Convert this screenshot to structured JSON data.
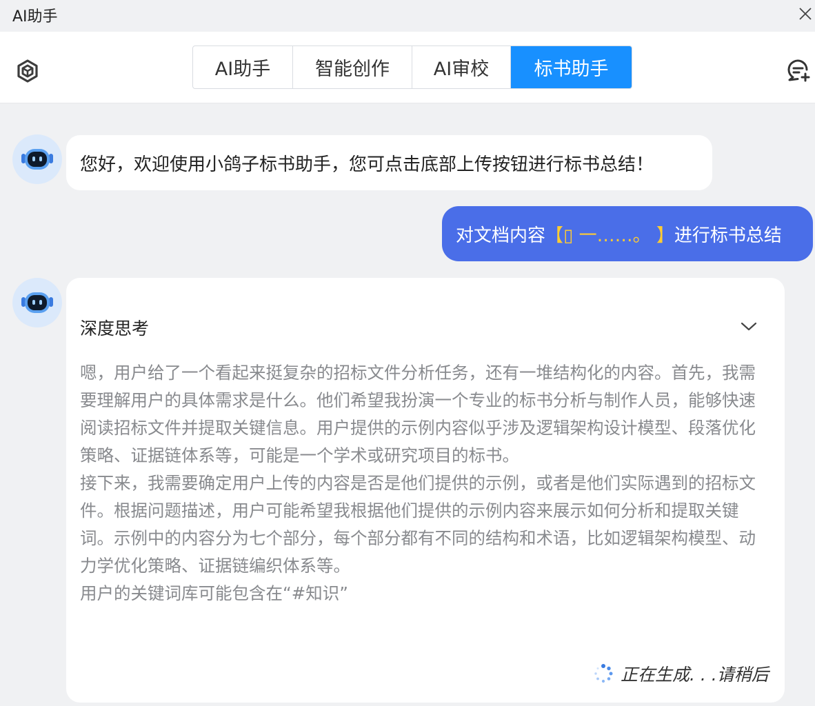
{
  "window": {
    "title": "AI助手"
  },
  "tabs": [
    {
      "label": "AI助手",
      "active": false
    },
    {
      "label": "智能创作",
      "active": false
    },
    {
      "label": "AI审校",
      "active": false
    },
    {
      "label": "标书助手",
      "active": true
    }
  ],
  "colors": {
    "accent": "#1890ff",
    "user_bubble": "#4a6ee8",
    "highlight": "#ffcc33"
  },
  "icons": {
    "logo": "cube-logo-icon",
    "new_chat": "new-chat-icon",
    "close": "close-icon",
    "collapse": "chevron-down-icon",
    "bot": "robot-icon",
    "loading": "spinner-icon"
  },
  "messages": {
    "greeting": "您好，欢迎使用小鸽子标书助手，您可点击底部上传按钮进行标书总结！",
    "user": {
      "prefix": "对文档内容",
      "highlight": "【▯ 一……。 】",
      "suffix": "进行标书总结"
    },
    "assistant": {
      "think_title": "深度思考",
      "paragraphs": [
        "嗯，用户给了一个看起来挺复杂的招标文件分析任务，还有一堆结构化的内容。首先，我需要理解用户的具体需求是什么。他们希望我扮演一个专业的标书分析与制作人员，能够快速阅读招标文件并提取关键信息。用户提供的示例内容似乎涉及逻辑架构设计模型、段落优化策略、证据链体系等，可能是一个学术或研究项目的标书。",
        "接下来，我需要确定用户上传的内容是否是他们提供的示例，或者是他们实际遇到的招标文件。根据问题描述，用户可能希望我根据他们提供的示例内容来展示如何分析和提取关键词。示例中的内容分为七个部分，每个部分都有不同的结构和术语，比如逻辑架构模型、动力学优化策略、证据链编织体系等。",
        "用户的关键词库可能包含在“#知识”"
      ],
      "status": "正在生成. . .请稍后"
    }
  }
}
